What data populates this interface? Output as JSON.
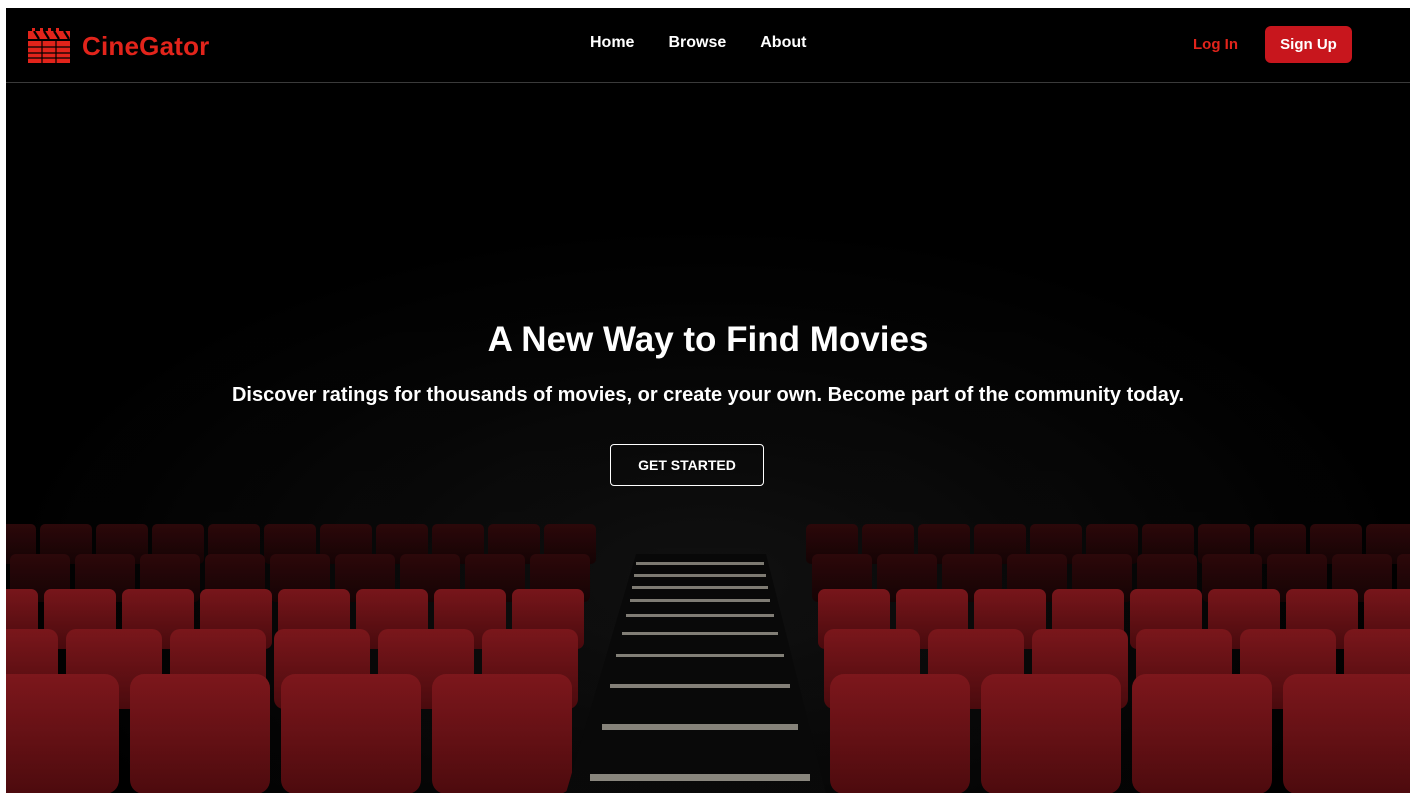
{
  "brand": {
    "name": "CineGator",
    "icon": "clapperboard-icon",
    "color": "#e2241b"
  },
  "nav": {
    "links": [
      {
        "label": "Home"
      },
      {
        "label": "Browse"
      },
      {
        "label": "About"
      }
    ],
    "login_label": "Log In",
    "signup_label": "Sign Up"
  },
  "hero": {
    "title": "A New Way to Find Movies",
    "subtitle": "Discover ratings for thousands of movies, or create your own. Become part of the community today.",
    "cta_label": "GET STARTED",
    "background": "cinema-seats-image"
  },
  "colors": {
    "accent": "#e2241b",
    "button_red": "#c8161d",
    "seat_red": "#8e1a1e",
    "background": "#000000"
  }
}
